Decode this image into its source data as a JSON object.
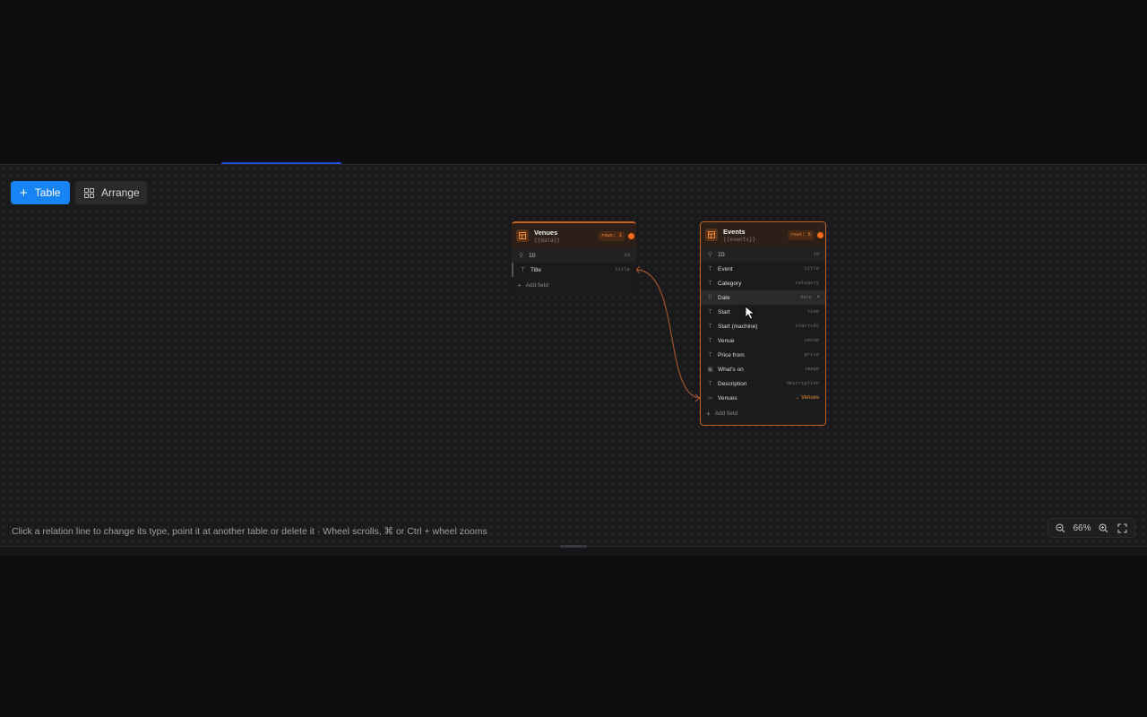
{
  "toolbar": {
    "add_table_label": "Table",
    "arrange_label": "Arrange"
  },
  "tables": {
    "venues": {
      "title": "Venues",
      "subtitle": "{{data}}",
      "rows_badge": "rows: 1",
      "fields": [
        {
          "name": "ID",
          "key": "id",
          "icon": "key-icon"
        },
        {
          "name": "Title",
          "key": "title",
          "icon": "text-icon"
        }
      ],
      "add_field_label": "Add field"
    },
    "events": {
      "title": "Events",
      "subtitle": "{{events}}",
      "rows_badge": "rows: 6",
      "fields": [
        {
          "name": "ID",
          "key": "id",
          "icon": "key-icon"
        },
        {
          "name": "Event",
          "key": "title",
          "icon": "text-icon"
        },
        {
          "name": "Category",
          "key": "category",
          "icon": "text-icon"
        },
        {
          "name": "Date",
          "key": "date",
          "icon": "drag-handle-icon"
        },
        {
          "name": "Start",
          "key": "time",
          "icon": "text-icon"
        },
        {
          "name": "Start (machine)",
          "key": "startsAt",
          "icon": "text-icon"
        },
        {
          "name": "Venue",
          "key": "venue",
          "icon": "text-icon"
        },
        {
          "name": "Price from",
          "key": "price",
          "icon": "text-icon"
        },
        {
          "name": "What's on",
          "key": "image",
          "icon": "image-icon"
        },
        {
          "name": "Description",
          "key": "description",
          "icon": "text-icon"
        },
        {
          "name": "Venues",
          "key": "→ Venues",
          "icon": "relation-icon"
        }
      ],
      "add_field_label": "Add field"
    }
  },
  "footer": {
    "hint": "Click a relation line to change its type, point it at another table or delete it · Wheel scrolls, ⌘ or Ctrl + wheel zooms",
    "zoom_level": "66%"
  },
  "colors": {
    "accent": "#1684f5",
    "table_accent": "#c8631f",
    "relation": "#e8903c"
  }
}
